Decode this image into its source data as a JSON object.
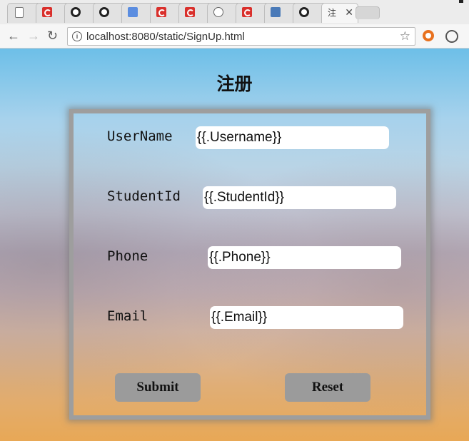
{
  "browser": {
    "active_tab_title": "注",
    "url": "localhost:8080/static/SignUp.html",
    "tabs": [
      {
        "icon": "document-icon"
      },
      {
        "icon": "red-c-icon"
      },
      {
        "icon": "github-icon"
      },
      {
        "icon": "github-icon"
      },
      {
        "icon": "google-translate-icon"
      },
      {
        "icon": "red-c-icon"
      },
      {
        "icon": "red-c-icon"
      },
      {
        "icon": "gray-icon"
      },
      {
        "icon": "red-c-icon"
      },
      {
        "icon": "blue-c-icon"
      },
      {
        "icon": "github-icon"
      }
    ]
  },
  "page": {
    "title": "注册",
    "fields": [
      {
        "label": "UserName",
        "value": "{{.Username}}"
      },
      {
        "label": "StudentId",
        "value": "{{.StudentId}}"
      },
      {
        "label": "Phone",
        "value": "{{.Phone}}"
      },
      {
        "label": "Email",
        "value": "{{.Email}}"
      }
    ],
    "submit_label": "Submit",
    "reset_label": "Reset"
  }
}
